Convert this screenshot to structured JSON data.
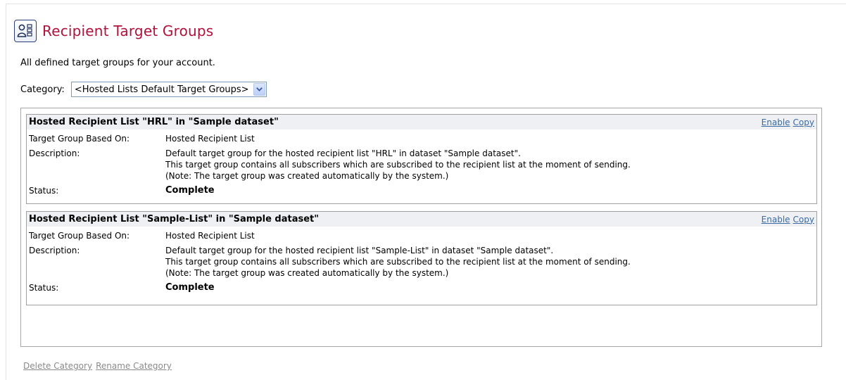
{
  "header": {
    "title": "Recipient Target Groups",
    "icon": "target-groups-icon",
    "title_color": "#b0123c"
  },
  "subtitle": "All defined target groups for your account.",
  "category": {
    "label": "Category:",
    "selected": "<Hosted Lists Default Target Groups>"
  },
  "groups": [
    {
      "title": "Hosted Recipient List \"HRL\" in \"Sample dataset\"",
      "enable_label": "Enable",
      "copy_label": "Copy",
      "based_on_label": "Target Group Based On:",
      "based_on_value": "Hosted Recipient List",
      "description_label": "Description:",
      "description_lines": [
        "Default target group for the hosted recipient list \"HRL\" in dataset \"Sample dataset\".",
        "This target group contains all subscribers which are subscribed to the recipient list at the moment of sending.",
        "(Note: The target group was created automatically by the system.)"
      ],
      "status_label": "Status:",
      "status_value": "Complete"
    },
    {
      "title": "Hosted Recipient List \"Sample-List\" in \"Sample dataset\"",
      "enable_label": "Enable",
      "copy_label": "Copy",
      "based_on_label": "Target Group Based On:",
      "based_on_value": "Hosted Recipient List",
      "description_label": "Description:",
      "description_lines": [
        "Default target group for the hosted recipient list \"Sample-List\" in dataset \"Sample dataset\".",
        "This target group contains all subscribers which are subscribed to the recipient list at the moment of sending.",
        "(Note: The target group was created automatically by the system.)"
      ],
      "status_label": "Status:",
      "status_value": "Complete"
    }
  ],
  "footer": {
    "delete_category": "Delete Category",
    "rename_category": "Rename Category"
  },
  "colors": {
    "link": "#3b6aa0",
    "disabled_link": "#8a8a8a",
    "card_header_bg": "#eef0f4"
  }
}
